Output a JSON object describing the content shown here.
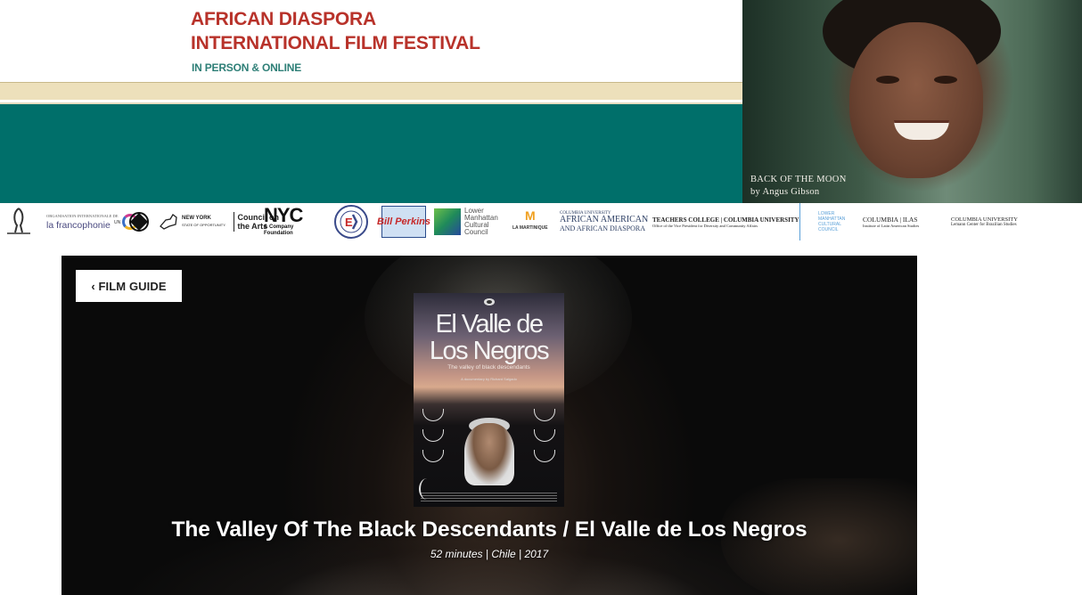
{
  "header": {
    "title_line1": "AFRICAN DIASPORA",
    "title_line2": "INTERNATIONAL FILM FESTIVAL",
    "subtitle": "IN PERSON & ONLINE",
    "photo_caption_line1": "BACK OF THE MOON",
    "photo_caption_line2": "by Angus Gibson",
    "colors": {
      "title": "#b8322a",
      "subtitle": "#2e7f77",
      "band_beige": "#ede0bb",
      "band_teal": "#006f6a"
    }
  },
  "sponsors": {
    "francophonie_line1": "ORGANISATION INTERNATIONALE DE",
    "francophonie_line2": "la francophonie",
    "nys_line1": "NEW YORK",
    "nys_line2": "STATE OF OPPORTUNITY.",
    "nys_council": "Council on the Arts",
    "nyc_logo": "NYC",
    "nyc_sub1": "& Company",
    "nyc_sub2": "Foundation",
    "perkins": "Bill Perkins",
    "lmcc_line1": "Lower",
    "lmcc_line2": "Manhattan",
    "lmcc_line3": "Cultural",
    "lmcc_line4": "Council",
    "martinique_logo": "M",
    "martinique": "LA MARTINIQUE",
    "cu_aaads_top": "COLUMBIA UNIVERSITY",
    "cu_aaads_line1": "AFRICAN AMERICAN",
    "cu_aaads_line2": "AND AFRICAN DIASPORA",
    "tc_line1": "TEACHERS COLLEGE | COLUMBIA UNIVERSITY",
    "tc_line2": "Office of the Vice President for Diversity and Community Affairs",
    "lmcc2_line1": "LOWER",
    "lmcc2_line2": "MANHATTAN",
    "lmcc2_line3": "CULTURAL",
    "lmcc2_line4": "COUNCIL",
    "ilas_line1": "COLUMBIA | ILAS",
    "ilas_line2": "Institute of Latin American Studies",
    "lemann_line1": "COLUMBIA UNIVERSITY",
    "lemann_line2": "Lemann Center for Brazilian Studies"
  },
  "main": {
    "back_button": "‹ FILM GUIDE",
    "poster": {
      "title_line1": "El Valle de",
      "title_line2": "Los Negros",
      "tagline": "The valley of black descendants",
      "credit": "A documentary by Richard Salgado"
    },
    "film_title": "The Valley Of The Black Descendants / El Valle de Los Negros",
    "film_meta": "52 minutes | Chile | 2017"
  }
}
